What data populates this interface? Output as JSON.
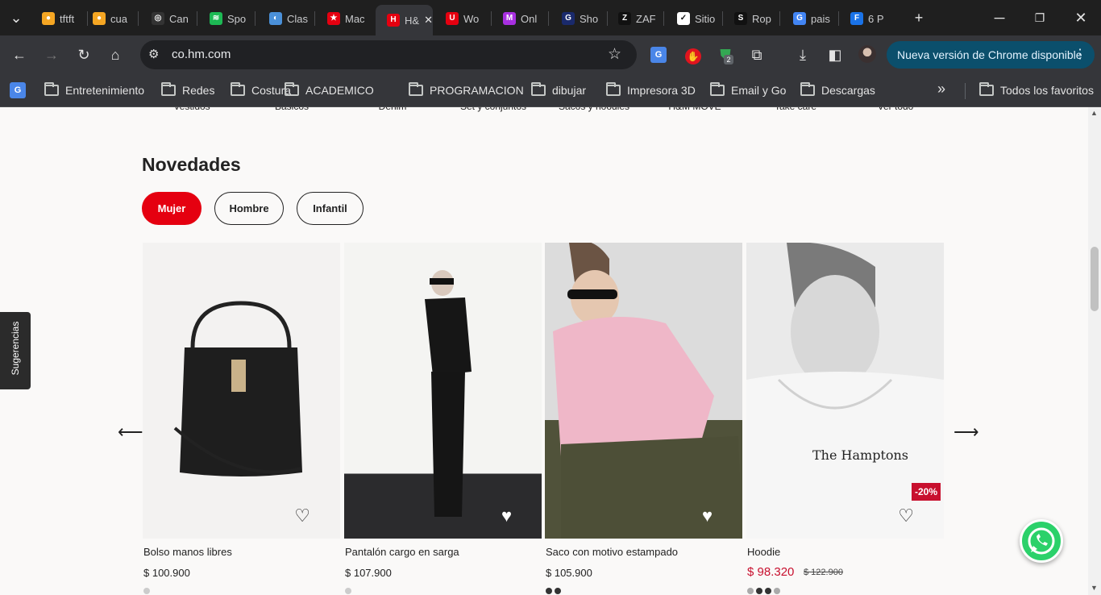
{
  "tabs": [
    {
      "label": "tftft",
      "color": "#f5a623",
      "glyph": "●"
    },
    {
      "label": "cua",
      "color": "#f5a623",
      "glyph": "●"
    },
    {
      "label": "Can",
      "color": "#333333",
      "glyph": "◎"
    },
    {
      "label": "Spo",
      "color": "#1db954",
      "glyph": "≋"
    },
    {
      "label": "Clas",
      "color": "#4a90d9",
      "glyph": "◐"
    },
    {
      "label": "Mac",
      "color": "#e50010",
      "glyph": "★"
    },
    {
      "label": "H&M",
      "color": "#e50010",
      "glyph": "H"
    },
    {
      "label": "Wo",
      "color": "#e50010",
      "glyph": "U"
    },
    {
      "label": "Onl",
      "color": "#a72fe0",
      "glyph": "M"
    },
    {
      "label": "Sho",
      "color": "#1a2a6c",
      "glyph": "G"
    },
    {
      "label": "ZAF",
      "color": "#111111",
      "glyph": "Z"
    },
    {
      "label": "Sitio",
      "color": "#ffffff",
      "glyph": "✓"
    },
    {
      "label": "Rop",
      "color": "#111111",
      "glyph": "S"
    },
    {
      "label": "pais",
      "color": "#4285f4",
      "glyph": "G"
    },
    {
      "label": "6 P",
      "color": "#1a73e8",
      "glyph": "F"
    }
  ],
  "toolbar": {
    "url": "co.hm.com",
    "update_label": "Nueva versión de Chrome disponible",
    "extension_badge": "2"
  },
  "bookmarks": [
    "Entretenimiento",
    "Redes",
    "Costura",
    "ACADEMICO",
    "PROGRAMACION",
    "dibujar",
    "Impresora 3D",
    "Email y Go",
    "Descargas"
  ],
  "all_bookmarks": "Todos los favoritos",
  "categories": [
    "Vestidos",
    "Básicos",
    "Denim",
    "Set y conjuntos",
    "Sacos y hoodies",
    "H&M MOVE",
    "Take care",
    "Ver todo"
  ],
  "section_title": "Novedades",
  "filters": [
    "Mujer",
    "Hombre",
    "Infantil"
  ],
  "products": [
    {
      "name": "Bolso manos libres",
      "price": "$ 100.900",
      "dots": [
        "#cccccc"
      ]
    },
    {
      "name": "Pantalón cargo en sarga",
      "price": "$ 107.900",
      "dots": [
        "#cccccc"
      ]
    },
    {
      "name": "Saco con motivo estampado",
      "price": "$ 105.900",
      "dots": [
        "#333333",
        "#333333"
      ]
    },
    {
      "name": "Hoodie",
      "price": "$ 98.320",
      "old_price": "$ 122.900",
      "discount": "-20%",
      "dots": [
        "#aaaaaa",
        "#333333",
        "#333333",
        "#aaaaaa"
      ]
    }
  ],
  "hoodie_print": "The Hamptons",
  "side_tab": "Sugerencias",
  "colors": {
    "brand_red": "#e50010",
    "update_blue": "#0b4f6c",
    "whatsapp": "#2bd16a"
  }
}
